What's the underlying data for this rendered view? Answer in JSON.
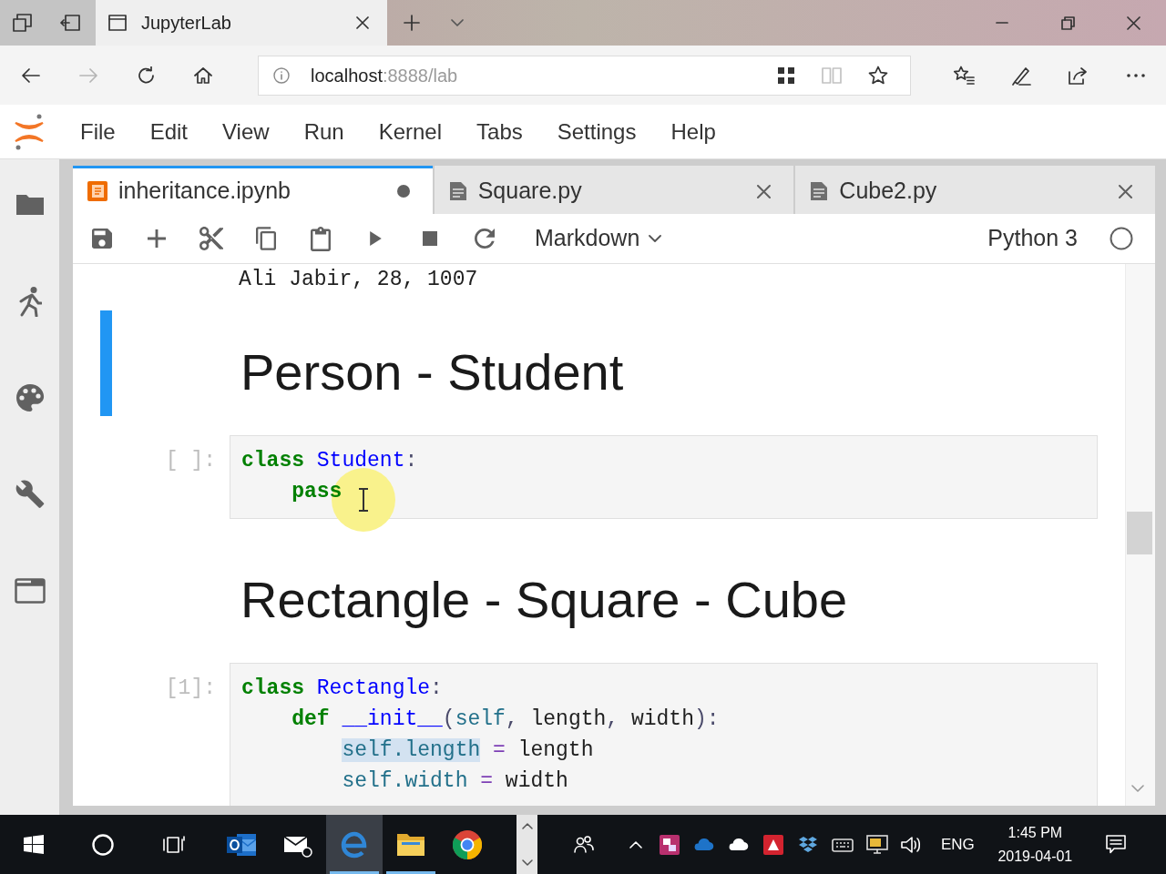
{
  "browser": {
    "tabs": [
      {
        "title": "JupyterLab",
        "selected": true
      }
    ],
    "nav": [
      {
        "kind": "back",
        "disabled": false
      },
      {
        "kind": "forward",
        "disabled": true
      },
      {
        "kind": "refresh",
        "disabled": false
      },
      {
        "kind": "home",
        "disabled": false
      }
    ],
    "address": {
      "host": "localhost",
      "rest": ":8888/lab"
    },
    "address_icons": [
      {
        "kind": "collections",
        "disabled": false
      },
      {
        "kind": "reading",
        "disabled": true
      },
      {
        "kind": "favorite",
        "disabled": false
      }
    ]
  },
  "menu": [
    "File",
    "Edit",
    "View",
    "Run",
    "Kernel",
    "Tabs",
    "Settings",
    "Help"
  ],
  "sidebar": [
    {
      "kind": "files"
    },
    {
      "kind": "running"
    },
    {
      "kind": "palette"
    },
    {
      "kind": "tools"
    },
    {
      "kind": "tabs"
    }
  ],
  "doc_tabs": [
    {
      "title": "inheritance.ipynb",
      "kind": "notebook",
      "selected": true,
      "modified": true
    },
    {
      "title": "Square.py",
      "kind": "file",
      "selected": false,
      "modified": false
    },
    {
      "title": "Cube2.py",
      "kind": "file",
      "selected": false,
      "modified": false
    }
  ],
  "toolbar": {
    "cell_type": "Markdown",
    "kernel": "Python 3",
    "kernel_busy": false
  },
  "cells": [
    {
      "kind": "output",
      "selected": false,
      "text": "Ali Jabir, 28, 1007"
    },
    {
      "kind": "markdown",
      "selected": true,
      "heading": "Person - Student"
    },
    {
      "kind": "code",
      "selected": false,
      "prompt": "[ ]:",
      "lines": [
        {
          "tokens": [
            {
              "text": "class",
              "kind": "keyword",
              "highlighted": false
            },
            {
              "text": " Student",
              "kind": "def",
              "highlighted": false
            },
            {
              "text": ":",
              "kind": "punct",
              "highlighted": false
            }
          ],
          "children": [
            {
              "tokens": [
                {
                  "text": "pass",
                  "kind": "keyword",
                  "highlighted": false
                }
              ]
            }
          ]
        }
      ]
    },
    {
      "kind": "markdown",
      "selected": false,
      "heading": "Rectangle - Square - Cube"
    },
    {
      "kind": "code",
      "selected": false,
      "prompt": "[1]:",
      "lines": [
        {
          "tokens": [
            {
              "text": "class",
              "kind": "keyword",
              "highlighted": false
            },
            {
              "text": " Rectangle",
              "kind": "def",
              "highlighted": false
            },
            {
              "text": ":",
              "kind": "punct",
              "highlighted": false
            }
          ],
          "children": [
            {
              "tokens": [
                {
                  "text": "def",
                  "kind": "keyword",
                  "highlighted": false
                },
                {
                  "text": " __init__",
                  "kind": "def",
                  "highlighted": false
                },
                {
                  "text": "(",
                  "kind": "punct",
                  "highlighted": false
                },
                {
                  "text": "self",
                  "kind": "variable",
                  "highlighted": false
                },
                {
                  "text": ",",
                  "kind": "punct",
                  "highlighted": false
                },
                {
                  "text": " length",
                  "kind": "plain",
                  "highlighted": false
                },
                {
                  "text": ",",
                  "kind": "punct",
                  "highlighted": false
                },
                {
                  "text": " width",
                  "kind": "plain",
                  "highlighted": false
                },
                {
                  "text": "):",
                  "kind": "punct",
                  "highlighted": false
                }
              ],
              "children": [
                {
                  "tokens": [
                    {
                      "text": "self.length",
                      "kind": "variable",
                      "highlighted": true
                    },
                    {
                      "text": " =",
                      "kind": "operator",
                      "highlighted": false
                    },
                    {
                      "text": " length",
                      "kind": "plain",
                      "highlighted": false
                    }
                  ]
                },
                {
                  "tokens": [
                    {
                      "text": "self.width",
                      "kind": "variable",
                      "highlighted": false
                    },
                    {
                      "text": " =",
                      "kind": "operator",
                      "highlighted": false
                    },
                    {
                      "text": " width",
                      "kind": "plain",
                      "highlighted": false
                    }
                  ]
                }
              ]
            }
          ]
        }
      ]
    }
  ],
  "taskbar": {
    "apps": [
      {
        "kind": "outlook",
        "running": false,
        "selected": false
      },
      {
        "kind": "mail",
        "running": false,
        "selected": false
      },
      {
        "kind": "edge",
        "running": true,
        "selected": true
      },
      {
        "kind": "explorer",
        "running": true,
        "selected": false
      },
      {
        "kind": "chrome",
        "running": false,
        "selected": false
      }
    ],
    "tray": {
      "language": "ENG",
      "time": "1:45 PM",
      "date": "2019-04-01"
    }
  }
}
